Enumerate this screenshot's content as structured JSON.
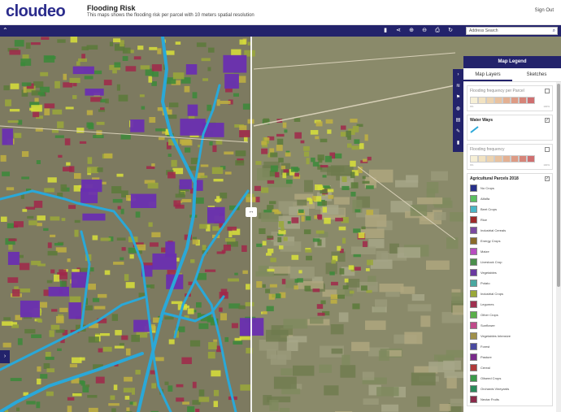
{
  "header": {
    "logo": "cloudeo",
    "title": "Flooding Risk",
    "subtitle": "This maps shows the flooding risk per parcel with 10 meters spatial resolution",
    "signout": "Sign Out"
  },
  "toolbar": {
    "search_placeholder": "Address Search",
    "buttons": [
      "bookmark-icon",
      "share-icon",
      "zoom-in-icon",
      "zoom-out-icon",
      "print-icon",
      "refresh-icon"
    ]
  },
  "map": {
    "divider_handle": "↔",
    "colors": {
      "river": "#2aa8d8",
      "purple_parcel": "#6a2fb0",
      "yellow_parcel": "#d8e03a",
      "green_parcel": "#3b8a3a",
      "red_parcel": "#a0284a"
    }
  },
  "legend": {
    "title": "Map Legend",
    "tabs": [
      "Map Layers",
      "Sketches"
    ],
    "flood_parcel": {
      "title": "Flooding frequency per Parcel",
      "min": "0%",
      "max": "100%",
      "colors": [
        "#f6efd6",
        "#f2e3c2",
        "#ecd3b0",
        "#e8c2a0",
        "#e3b092",
        "#dd9b85",
        "#d68579",
        "#cf6f70"
      ]
    },
    "water_ways": {
      "title": "Water Ways",
      "color": "#2aa8d8"
    },
    "flood_freq": {
      "title": "Flooding frequency",
      "min": "0%",
      "max": "100%",
      "colors": [
        "#f6efd6",
        "#f2e3c2",
        "#ecd3b0",
        "#e8c2a0",
        "#e3b092",
        "#dd9b85",
        "#d68579",
        "#cf6f70"
      ]
    },
    "parcels": {
      "title": "Agricultural Parcels 2018",
      "classes": [
        {
          "label": "No Crops",
          "color": "#27308a"
        },
        {
          "label": "Alfalfa",
          "color": "#5bbf60"
        },
        {
          "label": "Beet Crops",
          "color": "#49b6c6"
        },
        {
          "label": "Rice",
          "color": "#9e2a2a"
        },
        {
          "label": "Industrial Cereals",
          "color": "#7b4aa0"
        },
        {
          "label": "Energy Crops",
          "color": "#8a6a2a"
        },
        {
          "label": "Maize",
          "color": "#b74cc0"
        },
        {
          "label": "Livestock Crop",
          "color": "#4b8f4b"
        },
        {
          "label": "Vegetables",
          "color": "#6b3aa0"
        },
        {
          "label": "Potato",
          "color": "#4aa8a0"
        },
        {
          "label": "Industrial Crops",
          "color": "#9aa83a"
        },
        {
          "label": "Legumes",
          "color": "#a03050"
        },
        {
          "label": "Other Crops",
          "color": "#5ab04a"
        },
        {
          "label": "Sunflower",
          "color": "#c04a8a"
        },
        {
          "label": "Vegetables Intensive",
          "color": "#a0904a"
        },
        {
          "label": "Forest",
          "color": "#4a4aa0"
        },
        {
          "label": "Pasture",
          "color": "#7a2a8a"
        },
        {
          "label": "Cereal",
          "color": "#b03a3a"
        },
        {
          "label": "Oilseed Crops",
          "color": "#3a9a4a"
        },
        {
          "label": "Orchards Vineyards",
          "color": "#2a8a5a"
        },
        {
          "label": "Nectar Fruits",
          "color": "#8a2a4a"
        }
      ]
    }
  }
}
